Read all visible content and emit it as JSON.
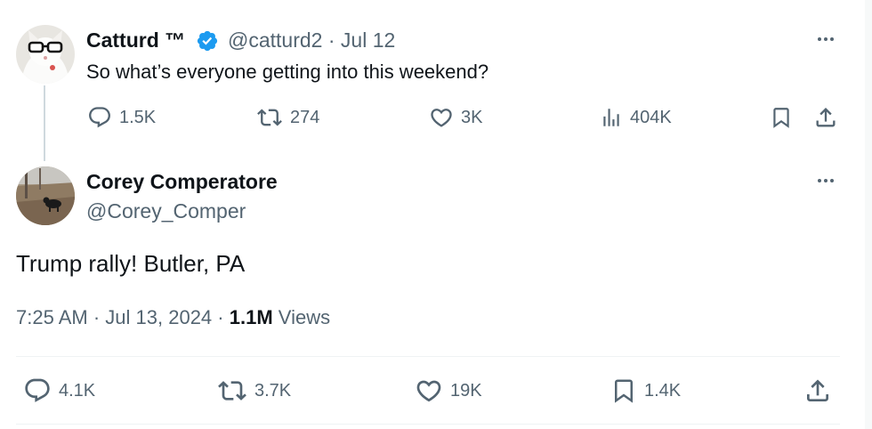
{
  "parent_tweet": {
    "author_name": "Catturd ™",
    "handle": "@catturd2",
    "separator": "·",
    "date": "Jul 12",
    "text": "So what’s everyone getting into this weekend?",
    "stats": {
      "replies": "1.5K",
      "reposts": "274",
      "likes": "3K",
      "views": "404K"
    }
  },
  "main_tweet": {
    "author_name": "Corey Comperatore",
    "handle": "@Corey_Comper",
    "text": "Trump rally! Butler, PA",
    "time": "7:25 AM",
    "dot1": "·",
    "date": "Jul 13, 2024",
    "dot2": "·",
    "views_count": "1.1M",
    "views_label": "Views",
    "stats": {
      "replies": "4.1K",
      "reposts": "3.7K",
      "likes": "19K",
      "bookmarks": "1.4K"
    }
  },
  "icons": {
    "verified": "verified-badge-icon",
    "reply": "reply-icon",
    "repost": "repost-icon",
    "like": "heart-icon",
    "views": "analytics-icon",
    "bookmark": "bookmark-icon",
    "share": "share-icon",
    "more": "more-icon"
  },
  "colors": {
    "text": "#0f1419",
    "secondary": "#536471",
    "verified": "#1d9bf0",
    "divider": "#eff3f4"
  }
}
